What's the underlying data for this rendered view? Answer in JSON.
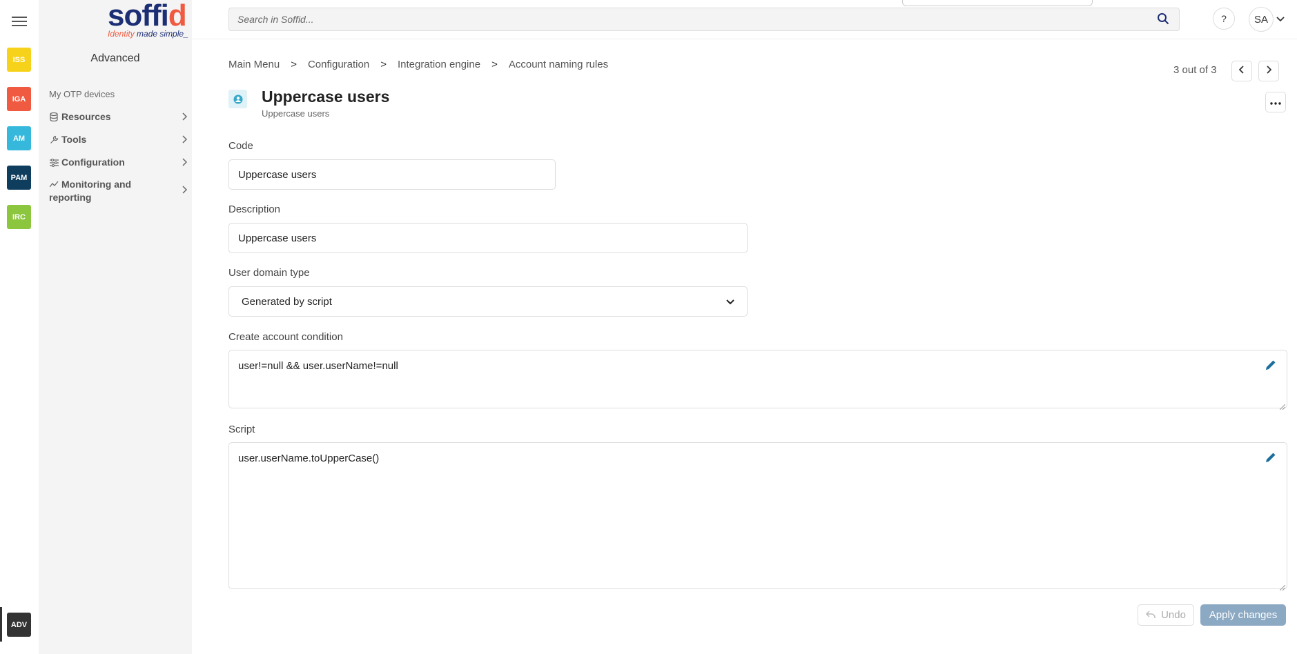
{
  "rail": {
    "modules": [
      {
        "code": "ISS",
        "color": "#f7d21a"
      },
      {
        "code": "IGA",
        "color": "#ef5a41"
      },
      {
        "code": "AM",
        "color": "#35b8dc"
      },
      {
        "code": "PAM",
        "color": "#0e3d5e"
      },
      {
        "code": "IRC",
        "color": "#8cc63f"
      }
    ],
    "active_module": {
      "code": "ADV",
      "color": "#333333"
    }
  },
  "menu": {
    "logo": {
      "brand": "soffid",
      "tagline_a": "Identity",
      "tagline_b": "made simple_"
    },
    "title": "Advanced",
    "items": [
      {
        "label": "My OTP devices",
        "icon": null
      },
      {
        "label": "Resources",
        "icon": "database-icon"
      },
      {
        "label": "Tools",
        "icon": "wrench-icon"
      },
      {
        "label": "Configuration",
        "icon": "sliders-icon"
      },
      {
        "label": "Monitoring and reporting",
        "icon": "chart-line-icon"
      }
    ]
  },
  "header": {
    "search_placeholder": "Search in Soffid...",
    "help_label": "?",
    "user_initials": "SA"
  },
  "breadcrumb": [
    "Main Menu",
    "Configuration",
    "Integration engine",
    "Account naming rules"
  ],
  "breadcrumb_separator": ">",
  "pager": {
    "text": "3 out of 3"
  },
  "page": {
    "title": "Uppercase users",
    "subtitle": "Uppercase users"
  },
  "form": {
    "code": {
      "label": "Code",
      "value": "Uppercase users"
    },
    "description": {
      "label": "Description",
      "value": "Uppercase users"
    },
    "user_domain_type": {
      "label": "User domain type",
      "value": "Generated by script"
    },
    "create_account_condition": {
      "label": "Create account condition",
      "value": "user!=null && user.userName!=null"
    },
    "script": {
      "label": "Script",
      "value": "user.userName.toUpperCase()"
    }
  },
  "actions": {
    "undo_label": "Undo",
    "apply_label": "Apply changes"
  },
  "colors": {
    "brand_blue": "#1c2e74",
    "brand_orange": "#ef5a41",
    "apply_disabled": "#8ba9c3"
  }
}
